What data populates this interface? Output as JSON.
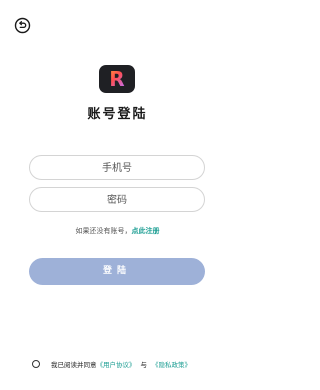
{
  "header": {
    "back_icon": "back-arrow-icon"
  },
  "logo": {
    "letter": "R",
    "bg_color": "#1f2024"
  },
  "title": "账号登陆",
  "form": {
    "phone_placeholder": "手机号",
    "phone_value": "",
    "password_placeholder": "密码",
    "password_value": ""
  },
  "register": {
    "hint": "如果还没有账号，",
    "link": "点此注册"
  },
  "login_button": {
    "label": "登陆",
    "color": "#9eb1d8"
  },
  "agreement": {
    "prefix": "我已阅读并同意",
    "user_agreement": "《用户协议》",
    "and": "与",
    "privacy_policy": "《隐私政策》",
    "link_color": "#1a9d92"
  }
}
